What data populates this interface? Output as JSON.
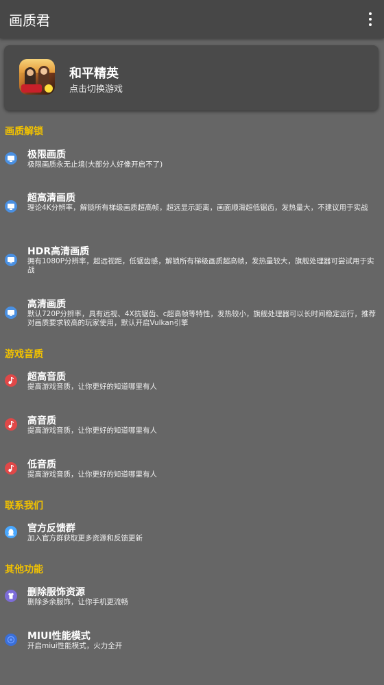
{
  "appbar": {
    "title": "画质君"
  },
  "game": {
    "name": "和平精英",
    "subtitle": "点击切换游戏"
  },
  "sections": {
    "quality": {
      "header": "画质解锁",
      "items": [
        {
          "title": "极限画质",
          "desc": "极限画质永无止境(大部分人好像开启不了)"
        },
        {
          "title": "超高清画质",
          "desc": "理论4K分辨率，解锁所有梯级画质超高帧，超远显示距离，画面顺滑超低锯齿，发热量大，不建议用于实战"
        },
        {
          "title": "HDR高清画质",
          "desc": "拥有1080P分辨率，超远视距，低锯齿感，解锁所有梯级画质超高帧，发热量较大，旗舰处理器可尝试用于实战"
        },
        {
          "title": "高清画质",
          "desc": "默认720P分辨率，具有远视、4X抗锯齿、c超高帧等特性，发热较小，旗舰处理器可以长时间稳定运行，推荐对画质要求较高的玩家使用，默认开启Vulkan引擎"
        }
      ]
    },
    "audio": {
      "header": "游戏音质",
      "items": [
        {
          "title": "超高音质",
          "desc": "提高游戏音质，让你更好的知道哪里有人"
        },
        {
          "title": "高音质",
          "desc": "提高游戏音质，让你更好的知道哪里有人"
        },
        {
          "title": "低音质",
          "desc": "提高游戏音质，让你更好的知道哪里有人"
        }
      ]
    },
    "contact": {
      "header": "联系我们",
      "items": [
        {
          "title": "官方反馈群",
          "desc": "加入官方群获取更多资源和反馈更新"
        }
      ]
    },
    "other": {
      "header": "其他功能",
      "items": [
        {
          "title": "删除服饰资源",
          "desc": "删除多余服饰，让你手机更流畅"
        },
        {
          "title": "MIUI性能模式",
          "desc": "开启miui性能模式，火力全开"
        }
      ]
    }
  },
  "colors": {
    "background": "#666666",
    "appbar": "#474747",
    "card": "#4a4a4a",
    "section_header": "#f2c200",
    "quality_icon": "#4a90e2",
    "audio_icon": "#e04848",
    "qq_icon": "#4aa8ff"
  }
}
